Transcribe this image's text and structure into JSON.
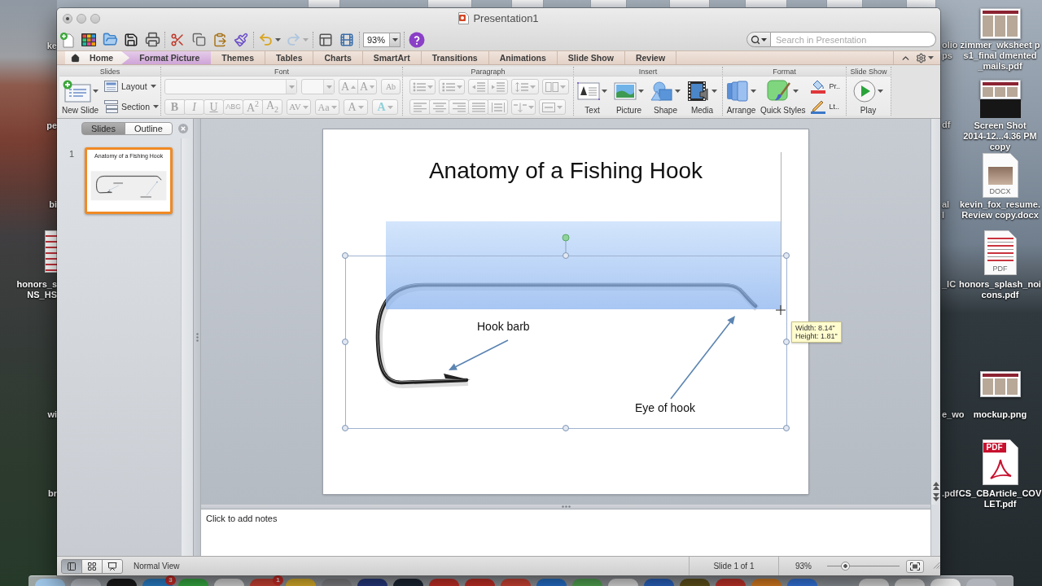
{
  "desktop": {
    "left_icons": [
      {
        "kind": "hidden",
        "label_lines": [
          "ke"
        ]
      },
      {
        "kind": "hidden",
        "label_lines": [
          "pe"
        ]
      },
      {
        "kind": "hidden",
        "label_lines": [
          "bi"
        ]
      },
      {
        "kind": "document",
        "label_lines": [
          "honors_s",
          "NS_HS"
        ]
      },
      {
        "kind": "hidden",
        "label_lines": [
          "wi"
        ]
      },
      {
        "kind": "hidden",
        "label_lines": [
          "br"
        ]
      }
    ],
    "cut_labels": [
      {
        "lines": [
          "olio",
          "ps"
        ]
      },
      {
        "lines": [
          "df"
        ]
      },
      {
        "lines": [
          "al",
          "l"
        ]
      },
      {
        "lines": [
          "_IC"
        ]
      },
      {
        "lines": [
          "e_wo"
        ]
      },
      {
        "lines": [
          ".pdf"
        ]
      }
    ],
    "right_icons": [
      {
        "kind": "thumbnail",
        "label_lines": [
          "zimmer_wksheet p",
          "s1_final dmented",
          "_mails.pdf"
        ]
      },
      {
        "kind": "screenshot",
        "label_lines": [
          "Screen Shot",
          "2014-12...4.36 PM",
          "copy"
        ]
      },
      {
        "kind": "docx",
        "badge": "DOCX",
        "label_lines": [
          "kevin_fox_resume.",
          "Review copy.docx"
        ]
      },
      {
        "kind": "pdf_page",
        "badge": "PDF",
        "label_lines": [
          "honors_splash_noi",
          "cons.pdf"
        ]
      },
      {
        "kind": "thumbnail",
        "label_lines": [
          "mockup.png"
        ]
      },
      {
        "kind": "acrobat",
        "badge": "PDF",
        "label_lines": [
          "CS_CBArticle_COV",
          "LET.pdf"
        ]
      }
    ]
  },
  "dock": {
    "badges": [
      "3",
      "1"
    ]
  },
  "window": {
    "title": "Presentation1",
    "unsaved": true
  },
  "toolbar": {
    "redo": {
      "disabled": true
    },
    "zoom": "93%",
    "search": {
      "placeholder": "Search in Presentation"
    }
  },
  "tabs": [
    {
      "label": "Home",
      "kind": "home",
      "selected": true
    },
    {
      "label": "Format Picture",
      "kind": "contextual",
      "selected": false
    },
    {
      "label": "Themes",
      "kind": "normal",
      "selected": false
    },
    {
      "label": "Tables",
      "kind": "normal",
      "selected": false
    },
    {
      "label": "Charts",
      "kind": "normal",
      "selected": false
    },
    {
      "label": "SmartArt",
      "kind": "normal",
      "selected": false
    },
    {
      "label": "Transitions",
      "kind": "normal",
      "selected": false
    },
    {
      "label": "Animations",
      "kind": "normal",
      "selected": false
    },
    {
      "label": "Slide Show",
      "kind": "normal",
      "selected": false
    },
    {
      "label": "Review",
      "kind": "normal",
      "selected": false
    }
  ],
  "ribbon": {
    "groups": [
      {
        "title": "Slides",
        "kind": "slides",
        "disabled": false,
        "buttons": [
          {
            "label": "New Slide"
          },
          {
            "label": "Layout"
          },
          {
            "label": "Section"
          }
        ]
      },
      {
        "title": "Font",
        "kind": "font",
        "disabled": true,
        "buttons": [
          {
            "label": "A",
            "kind": "grow"
          },
          {
            "label": "A",
            "kind": "shrink"
          },
          {
            "label": "Ab",
            "kind": "clear"
          },
          {
            "label": "B",
            "kind": "bold"
          },
          {
            "label": "I",
            "kind": "italic"
          },
          {
            "label": "U",
            "kind": "underline"
          },
          {
            "label": "ABC",
            "kind": "strike"
          },
          {
            "label": "A$^{2}$",
            "kind": "superscript"
          },
          {
            "label": "A$_{2}$",
            "kind": "subscript"
          },
          {
            "label": "AV",
            "kind": "spacing"
          },
          {
            "label": "Aa",
            "kind": "case"
          },
          {
            "label": "A",
            "kind": "color"
          },
          {
            "label": "A",
            "kind": "effects"
          }
        ]
      },
      {
        "title": "Paragraph",
        "kind": "paragraph",
        "disabled": true
      },
      {
        "title": "Insert",
        "kind": "insert",
        "disabled": false,
        "buttons": [
          {
            "label": "Text"
          },
          {
            "label": "Picture"
          },
          {
            "label": "Shape"
          },
          {
            "label": "Media"
          }
        ]
      },
      {
        "title": "Format",
        "kind": "format",
        "disabled": false,
        "buttons": [
          {
            "label": "Arrange"
          },
          {
            "label": "Quick Styles"
          },
          {
            "label": "Pr.."
          },
          {
            "label": "Lt.."
          }
        ]
      },
      {
        "title": "Slide Show",
        "kind": "slideshow",
        "disabled": false,
        "buttons": [
          {
            "label": "Play"
          }
        ]
      }
    ]
  },
  "slide_panel": {
    "tabs": [
      {
        "label": "Slides",
        "selected": true
      },
      {
        "label": "Outline",
        "selected": false
      }
    ],
    "thumbnails": [
      {
        "number": "1",
        "title": "Anatomy of a Fishing Hook",
        "selected": true
      }
    ]
  },
  "slide": {
    "title": "Anatomy of a Fishing Hook",
    "callouts": [
      {
        "text": "Hook barb"
      },
      {
        "text": "Eye of hook"
      }
    ],
    "size_tooltip": [
      "Width: 8.14\"",
      "Height: 1.81\""
    ]
  },
  "notes": {
    "placeholder": "Click to add notes"
  },
  "status_bar": {
    "view_buttons": [
      {
        "selected": true
      },
      {
        "selected": false
      },
      {
        "selected": false
      }
    ],
    "view_name": "Normal View",
    "slide_position": "Slide 1 of 1",
    "zoom": "93%",
    "zoom_slider": {
      "level": 0.22
    }
  }
}
